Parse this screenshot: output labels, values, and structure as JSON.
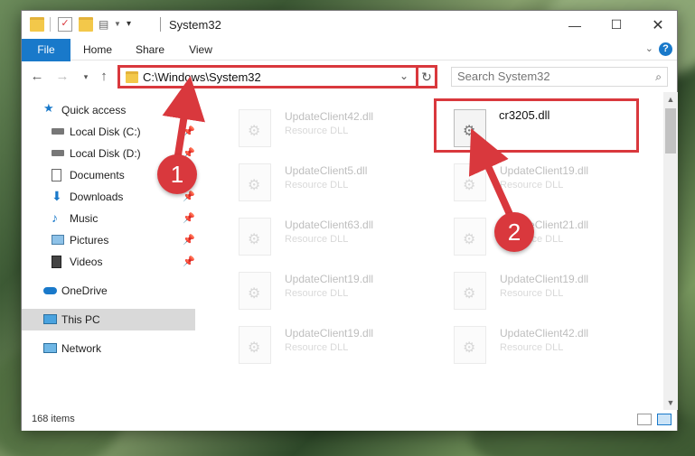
{
  "window": {
    "title": "System32"
  },
  "ribbon": {
    "tabs": [
      "File",
      "Home",
      "Share",
      "View"
    ],
    "help_icon": "?"
  },
  "nav": {
    "address": "C:\\Windows\\System32",
    "search_placeholder": "Search System32"
  },
  "sidebar": {
    "items": [
      {
        "label": "Quick access",
        "icon": "star-icon",
        "pinned": false
      },
      {
        "label": "Local Disk (C:)",
        "icon": "drive-icon",
        "pinned": true
      },
      {
        "label": "Local Disk (D:)",
        "icon": "drive-icon",
        "pinned": true
      },
      {
        "label": "Documents",
        "icon": "documents-icon",
        "pinned": true
      },
      {
        "label": "Downloads",
        "icon": "downloads-icon",
        "pinned": true
      },
      {
        "label": "Music",
        "icon": "music-icon",
        "pinned": true
      },
      {
        "label": "Pictures",
        "icon": "pictures-icon",
        "pinned": true
      },
      {
        "label": "Videos",
        "icon": "videos-icon",
        "pinned": true
      },
      {
        "label": "OneDrive",
        "icon": "cloud-icon",
        "pinned": false
      },
      {
        "label": "This PC",
        "icon": "computer-icon",
        "pinned": false,
        "selected": true
      },
      {
        "label": "Network",
        "icon": "network-icon",
        "pinned": false
      }
    ]
  },
  "files": {
    "left_column": [
      {
        "name": "UpdateClient42.dll",
        "type": "Resource DLL"
      },
      {
        "name": "UpdateClient5.dll",
        "type": "Resource DLL"
      },
      {
        "name": "UpdateClient63.dll",
        "type": "Resource DLL"
      },
      {
        "name": "UpdateClient19.dll",
        "type": "Resource DLL"
      },
      {
        "name": "UpdateClient19.dll",
        "type": "Resource DLL"
      }
    ],
    "right_column": [
      {
        "name": "cr3205.dll",
        "type": ""
      },
      {
        "name": "UpdateClient19.dll",
        "type": "Resource DLL"
      },
      {
        "name": "UpdateClient21.dll",
        "type": "Resource DLL"
      },
      {
        "name": "UpdateClient19.dll",
        "type": "Resource DLL"
      },
      {
        "name": "UpdateClient42.dll",
        "type": "Resource DLL"
      }
    ]
  },
  "status": {
    "item_count": "168 items"
  },
  "callouts": {
    "step1": "1",
    "step2": "2"
  },
  "colors": {
    "accent": "#1979ca",
    "callout": "#d9383d"
  }
}
